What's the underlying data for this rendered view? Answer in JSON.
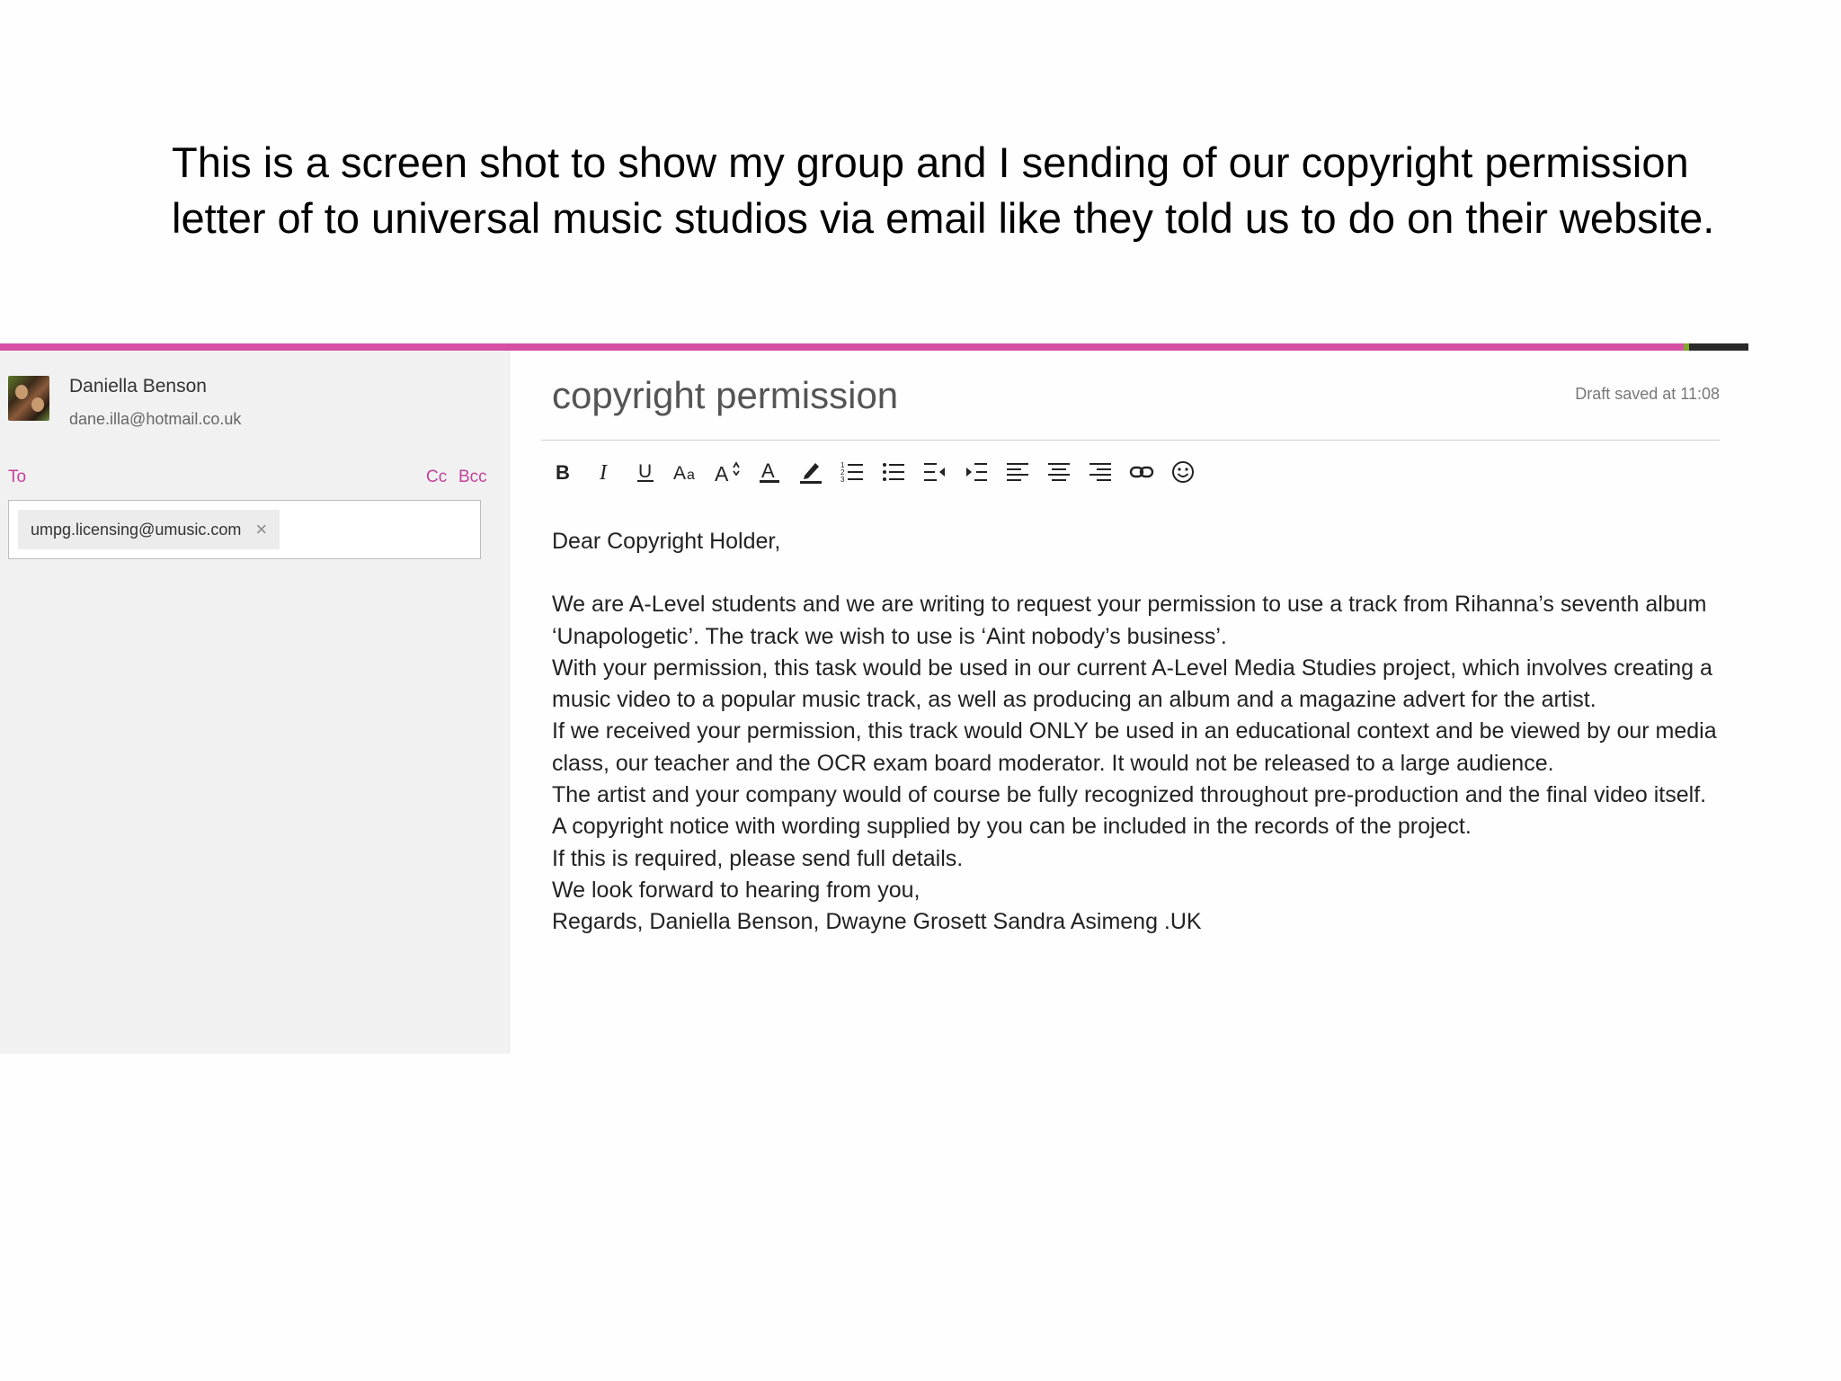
{
  "caption": "This is a screen shot to show my group and I sending of our copyright  permission letter of to universal music studios via email like they told us to do on their website.",
  "sidebar": {
    "sender_name": "Daniella Benson",
    "sender_email": "dane.illa@hotmail.co.uk",
    "to_label": "To",
    "cc_label": "Cc",
    "bcc_label": "Bcc",
    "recipient": "umpg.licensing@umusic.com",
    "remove_symbol": "×"
  },
  "compose": {
    "subject": "copyright permission",
    "draft_status": "Draft saved at 11:08",
    "toolbar_icons": [
      "bold-icon",
      "italic-icon",
      "underline-icon",
      "font-size-icon",
      "grow-font-icon",
      "font-color-icon",
      "highlight-icon",
      "numbered-list-icon",
      "bulleted-list-icon",
      "decrease-indent-icon",
      "increase-indent-icon",
      "align-left-icon",
      "align-center-icon",
      "align-right-icon",
      "link-icon",
      "emoji-icon"
    ],
    "body": {
      "greeting": "Dear Copyright Holder,",
      "p1": "We are A-Level students and we are writing to request your permission to use a track from Rihanna’s seventh album ‘Unapologetic’.  The track we wish to use is ‘Aint nobody’s business’.",
      "p2": "With your permission, this task would be used in our current A-Level Media Studies project, which involves creating a music video to a popular music track, as well as producing an album and a magazine advert for the artist.",
      "p3": "If we received your permission, this track would ONLY be used in an educational context and be viewed by our media class, our teacher and the OCR exam board moderator.  It would not be released to a large audience.",
      "p4": "The artist and your company would of course be fully recognized throughout pre-production and the final video itself.  A copyright notice with wording supplied by you can be included in the records of the project.",
      "p5": "If this is required, please send full details.",
      "p6": "We look forward to hearing from you,",
      "p7": "Regards,  Daniella Benson, Dwayne Grosett Sandra Asimeng .UK"
    }
  }
}
